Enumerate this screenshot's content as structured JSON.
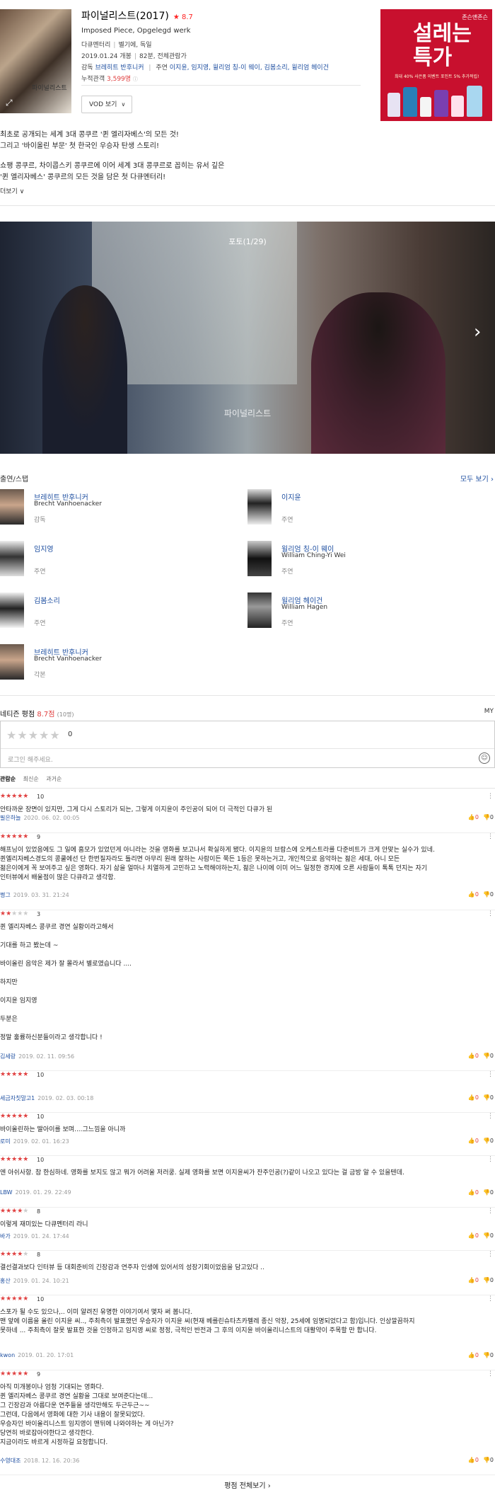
{
  "movie": {
    "title": "파이널리스트(2017)",
    "score_label": "★ 8.7",
    "original_title": "Imposed Piece, Opgelegd werk",
    "genre": "다큐멘터리",
    "country": "벨기에, 독일",
    "release": "2019.01.24 개봉",
    "runtime": "82분, 전체관람가",
    "credits_prefix": "감독",
    "director": "브레히트 반후니커",
    "cast_prefix": "주연",
    "cast_list": "이지윤, 임지영, 윌리엄 칭-이 웨이, 김봄소리, 윌리엄 헤이건",
    "audience_prefix": "누적관객",
    "audience": "3,599명",
    "poster_text": "파이널리스트",
    "vod_button": "VOD 보기"
  },
  "ad": {
    "brand": "존슨앤존슨",
    "headline": "설레는 특가",
    "sub": "최대 40% 사은품 이벤트 포인트 5% 추가적립!"
  },
  "description": {
    "line1": "최초로 공개되는 세계 3대 콩쿠르 '퀸 엘리자베스'의 모든 것!",
    "line2": "그리고 '바이올린 부문' 첫 한국인 우승자 탄생 스토리!",
    "line3": "쇼팽 콩쿠르, 차이콥스키 콩쿠르에 이어 세계 3대 콩쿠르로 꼽히는 유서 깊은",
    "line4": "'퀸 엘리자베스' 콩쿠르의 모든 것을 담은 첫 다큐멘터리!",
    "more": "더보기"
  },
  "photo": {
    "counter": "포토(1/29)",
    "caption": "파이널리스트"
  },
  "cast_section": {
    "title": "출연/스탭",
    "all": "모두 보기",
    "people": [
      {
        "name": "브레히트 반후니커",
        "en": "Brecht Vanhoenacker",
        "role": "감독"
      },
      {
        "name": "이지윤",
        "en": "",
        "role": "주연"
      },
      {
        "name": "임지영",
        "en": "",
        "role": "주연"
      },
      {
        "name": "윌리엄 칭-이 웨이",
        "en": "William Ching-Yi Wei",
        "role": "주연"
      },
      {
        "name": "김봄소리",
        "en": "",
        "role": "주연"
      },
      {
        "name": "윌리엄 헤이건",
        "en": "William Hagen",
        "role": "주연"
      },
      {
        "name": "브레히트 반후니커",
        "en": "Brecht Vanhoenacker",
        "role": "각본"
      }
    ]
  },
  "reviews_section": {
    "title": "네티즌 평점",
    "score": "8.7점",
    "count": "(10명)",
    "my": "MY",
    "empty_stars": "★★★★★",
    "zero": "0",
    "placeholder": "로그인 해주세요.",
    "sort": [
      "관람순",
      "최신순",
      "과거순"
    ],
    "all_button": "평점 전체보기"
  },
  "reviews": [
    {
      "rating": 10,
      "text": "안타까운 장면이 있지만, 그게 다시 스토리가 되는, 그렇게 이지윤이 주인공이 되어 더 극적인 다큐가 된",
      "nick": "필은하늘",
      "date": "2020. 06. 02. 00:05",
      "up": "0",
      "down": "0"
    },
    {
      "rating": 9,
      "text": "해프닝이 있었음에도 그 일에 흠모가 있었던게 아니라는 것을 영화를 보고나서 확실하게 됐다. 이지윤의 브람스에 오케스트라를 다준비트가 크게 안맞는 실수가 있네.\n퀸엘리자베스경도의 콩쿨에선 단 한번질자라도 틀리면 아무리 원래 잘하는 사람이든 쭉든 1등은 못하는거고, 개인적으로 음악하는 젊은 세대, 아니 모든\n젊은이에게 꼭 보여주고 싶은 영화다. 자기 삶을 얼마나 치열하게 고민하고 노력해야하는지, 젊은 나이에 이미 어느 일정한 경지에 오른 사람들이 톡톡 던지는 자기\n인터뷰에서 배울점이 많은 다큐라고 생각함.",
      "nick": "쩡그",
      "date": "2019. 03. 31. 21:24",
      "up": "0",
      "down": "0"
    },
    {
      "rating": 3,
      "text": "퀸 엘리자베스 콩쿠르 경연 실황이라고해서\n\n기대를 하고 봤는데 ~\n\n바이올린 음악은 제가 잘 몰라서 별로였습니다 ....\n\n하지만\n\n이지윤 임지영\n\n두분은\n\n정말 훌륭하신분들이라고 생각합니다 !",
      "nick": "김세랑",
      "date": "2019. 02. 11. 09:56",
      "up": "0",
      "down": "0"
    },
    {
      "rating": 10,
      "text": "",
      "nick": "세금자칫말고1",
      "date": "2019. 02. 03. 00:18",
      "up": "0",
      "down": "0"
    },
    {
      "rating": 10,
      "text": "바이올린하는 딸아이를 보며....그느낌을 아니까",
      "nick": "로미",
      "date": "2019. 02. 01. 16:23",
      "up": "0",
      "down": "0"
    },
    {
      "rating": 10,
      "text": "엔 아쉬사항. 참 한심하네. 영화를 보지도 않고 뭐가 어려울 저러쿵. 실제 영화를 보면 이지윤씨가 잔주인공(?)같이 나오고 있다는 걸 금방 알 수 있을텐데.",
      "nick": "LBW",
      "date": "2019. 01. 29. 22:49",
      "up": "0",
      "down": "0"
    },
    {
      "rating": 8,
      "text": "이렇게  재미있는 다큐멘터리 라니",
      "nick": "바가",
      "date": "2019. 01. 24. 17:44",
      "up": "0",
      "down": "0"
    },
    {
      "rating": 8,
      "text": "결선결과보다 인터뷰 등 대회준비의 긴장감과 연주자 인생에 있어서의 성장기회이었음을 담고있다 ..",
      "nick": "홍산",
      "date": "2019. 01. 24. 10:21",
      "up": "0",
      "down": "0"
    },
    {
      "rating": 10,
      "text": "스포가 될 수도 있으나,.. 이미 알려진 유명한 이야기여서 몇자 써 봅니다.\n맨 앞에 이름을 올린 이지윤 씨.., 주최측이 발표했던 우승자가 이지윤 씨(현재 베를린슈타츠카펠레 종신 악장, 25세에 임명되었다고 함)입니다. 인상깔끔하지\n못하네 ... 주최측이 잘못 발표한 것을 인정하고 임지영 씨로 정정, 극적인 반전과 그 후의 이지윤 바이올리니스트의 대활약이 주목할 만 합니다.",
      "nick": "kwon",
      "date": "2019. 01. 20. 17:01",
      "up": "0",
      "down": "0"
    },
    {
      "rating": 9,
      "text": "아직 미개봉이나 엄청 기대되는 영화다.\n퀸 엘리자베스 콩쿠르 경연 실황을 그대로 보여준다는데...\n그 긴장감과 아름다운 연주들을 생각만해도 두근두근~~\n그런데, 다음에서 영화에 대한 기사 내용이 잘못되었다.\n우승자인 바이올리니스트 임지영이 맨뒤에 나와야하는 게 아닌가?\n당연히 바로잡아야한다고 생각한다.\n지금이라도 바르게 시정하길 요청합니다.",
      "nick": "수영대조",
      "date": "2018. 12. 16. 20:36",
      "up": "0",
      "down": "0"
    }
  ]
}
